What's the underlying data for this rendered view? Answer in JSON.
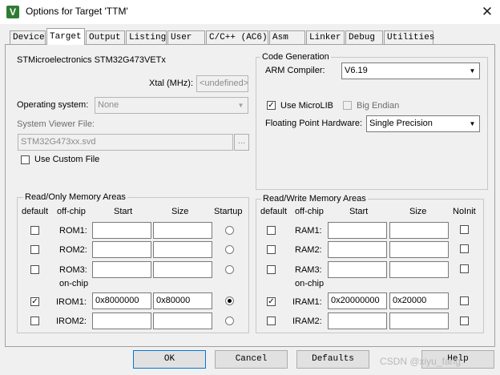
{
  "window": {
    "title": "Options for Target 'TTM'",
    "close_glyph": "✕",
    "app_icon_glyph": "V"
  },
  "tabs": [
    "Device",
    "Target",
    "Output",
    "Listing",
    "User",
    "C/C++ (AC6)",
    "Asm",
    "Linker",
    "Debug",
    "Utilities"
  ],
  "active_tab": "Target",
  "device_name": "STMicroelectronics STM32G473VETx",
  "xtal": {
    "label": "Xtal (MHz):",
    "value": "<undefined>"
  },
  "os": {
    "label": "Operating system:",
    "value": "None"
  },
  "svd": {
    "label": "System Viewer File:",
    "value": "STM32G473xx.svd",
    "browse": "..."
  },
  "use_custom_file": {
    "label": "Use Custom File",
    "checked": false
  },
  "code_gen": {
    "title": "Code Generation",
    "arm_compiler_label": "ARM Compiler:",
    "arm_compiler_value": "V6.19",
    "use_microlib_label": "Use MicroLIB",
    "use_microlib_checked": true,
    "big_endian_label": "Big Endian",
    "big_endian_checked": false,
    "fp_label": "Floating Point Hardware:",
    "fp_value": "Single Precision"
  },
  "ro_memory": {
    "title": "Read/Only Memory Areas",
    "headers": {
      "default": "default",
      "offchip": "off-chip",
      "start": "Start",
      "size": "Size",
      "last": "Startup"
    },
    "onchip_label": "on-chip",
    "rows": [
      {
        "name": "ROM1:",
        "default_checked": false,
        "start": "",
        "size": "",
        "startup": false
      },
      {
        "name": "ROM2:",
        "default_checked": false,
        "start": "",
        "size": "",
        "startup": false
      },
      {
        "name": "ROM3:",
        "default_checked": false,
        "start": "",
        "size": "",
        "startup": false
      },
      {
        "name": "IROM1:",
        "default_checked": true,
        "start": "0x8000000",
        "size": "0x80000",
        "startup": true
      },
      {
        "name": "IROM2:",
        "default_checked": false,
        "start": "",
        "size": "",
        "startup": false
      }
    ]
  },
  "rw_memory": {
    "title": "Read/Write Memory Areas",
    "headers": {
      "default": "default",
      "offchip": "off-chip",
      "start": "Start",
      "size": "Size",
      "last": "NoInit"
    },
    "onchip_label": "on-chip",
    "rows": [
      {
        "name": "RAM1:",
        "default_checked": false,
        "start": "",
        "size": "",
        "noinit": false
      },
      {
        "name": "RAM2:",
        "default_checked": false,
        "start": "",
        "size": "",
        "noinit": false
      },
      {
        "name": "RAM3:",
        "default_checked": false,
        "start": "",
        "size": "",
        "noinit": false
      },
      {
        "name": "IRAM1:",
        "default_checked": true,
        "start": "0x20000000",
        "size": "0x20000",
        "noinit": false
      },
      {
        "name": "IRAM2:",
        "default_checked": false,
        "start": "",
        "size": "",
        "noinit": false
      }
    ]
  },
  "buttons": {
    "ok": "OK",
    "cancel": "Cancel",
    "defaults": "Defaults",
    "help": "Help"
  },
  "watermark": "CSDN @xiyu_fang"
}
